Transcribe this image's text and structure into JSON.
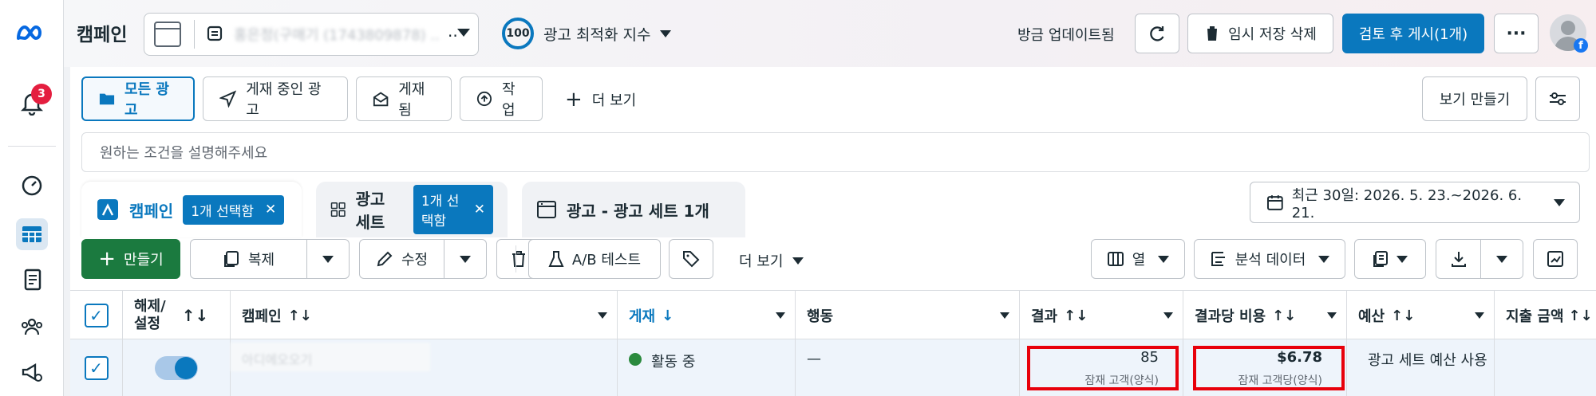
{
  "topbar": {
    "title": "캠페인",
    "account_selector": "홍은정(구매기 (1743809878) ..",
    "opt_score": "100",
    "opt_label": "광고 최적화 지수",
    "updated": "방금 업데이트됨",
    "discard_label": "임시 저장 삭제",
    "publish_label": "검토 후 게시(1개)"
  },
  "rail": {
    "notification_count": "3"
  },
  "view_tabs": {
    "all": "모든 광고",
    "active": "게재 중인 광고",
    "published": "게재됨",
    "actions": "작업",
    "more": "더 보기",
    "make_view": "보기 만들기"
  },
  "search": {
    "placeholder": "원하는 조건을 설명해주세요"
  },
  "levels": {
    "campaign": "캠페인",
    "campaign_chip": "1개 선택함",
    "adset": "광고 세트",
    "adset_chip": "1개 선택함",
    "ad": "광고 - 광고 세트 1개"
  },
  "date_range": "최근 30일: 2026. 5. 23.~2026. 6. 21.",
  "toolbar": {
    "create": "만들기",
    "duplicate": "복제",
    "edit": "수정",
    "ab_test": "A/B 테스트",
    "more": "더 보기",
    "columns": "열",
    "breakdown": "분석 데이터"
  },
  "table": {
    "headers": {
      "toggle": "해제/\n설정",
      "campaign": "캠페인",
      "delivery": "게재",
      "action": "행동",
      "results": "결과",
      "cost_per_result": "결과당 비용",
      "budget": "예산",
      "amount_spent": "지출 금액"
    },
    "row": {
      "campaign_name": "아디에오오기",
      "delivery": "활동 중",
      "action": "—",
      "results": "85",
      "results_sub": "잠재 고객(양식)",
      "cost": "$6.78",
      "cost_sub": "잠재 고객당(양식)",
      "budget": "광고 세트 예산 사용"
    }
  },
  "colors": {
    "accent": "#0a78be",
    "active_green": "#2b8a3e",
    "highlight": "#e8000b"
  }
}
